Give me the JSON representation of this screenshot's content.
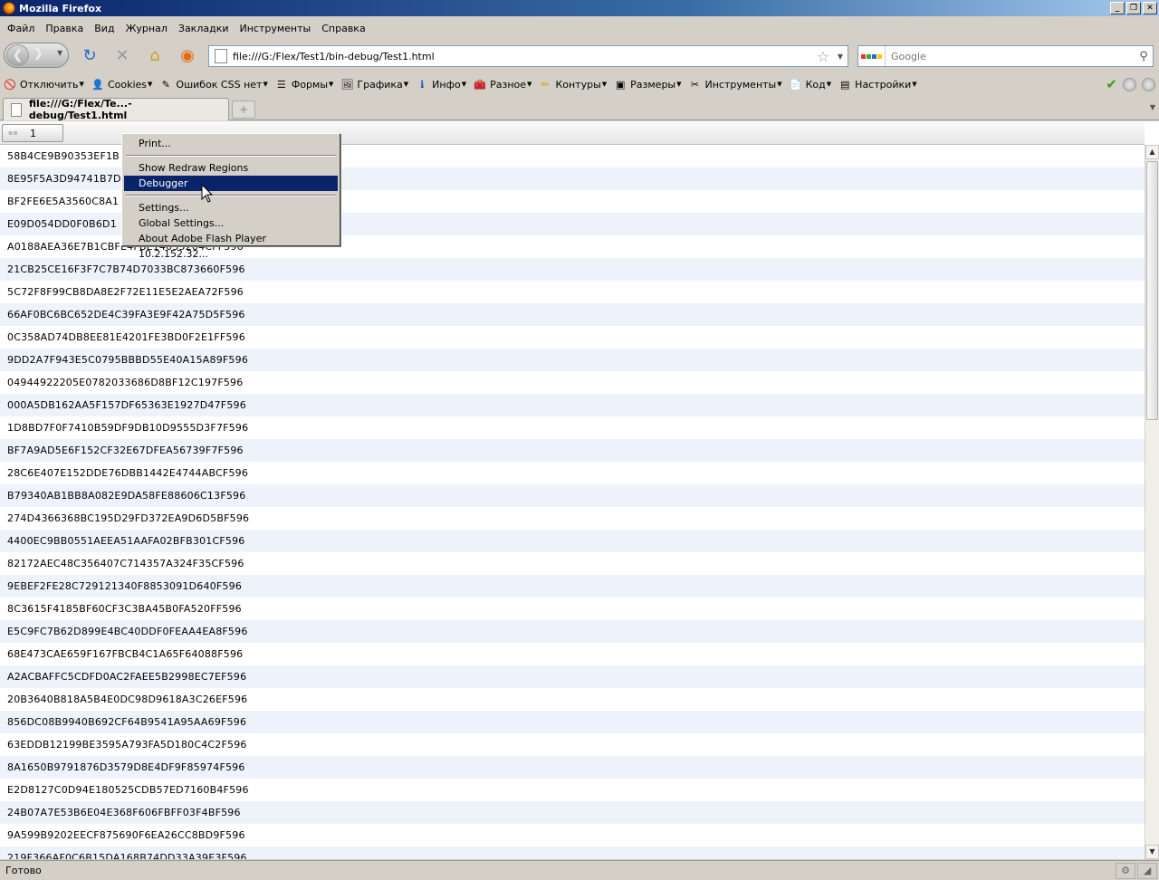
{
  "window": {
    "title": "Mozilla Firefox",
    "buttons": [
      "_",
      "❐",
      "✕"
    ]
  },
  "menu": [
    "Файл",
    "Правка",
    "Вид",
    "Журнал",
    "Закладки",
    "Инструменты",
    "Справка"
  ],
  "nav": {
    "url": "file:///G:/Flex/Test1/bin-debug/Test1.html",
    "search_placeholder": "Google"
  },
  "devbar": [
    {
      "label": "Отключить",
      "icon": "🚫"
    },
    {
      "label": "Cookies",
      "icon": "👤"
    },
    {
      "label": "Ошибок CSS нет",
      "icon": "✎"
    },
    {
      "label": "Формы",
      "icon": "☰"
    },
    {
      "label": "Графика",
      "icon": "🖼"
    },
    {
      "label": "Инфо",
      "icon": "ℹ"
    },
    {
      "label": "Разное",
      "icon": "🧰"
    },
    {
      "label": "Контуры",
      "icon": "✏"
    },
    {
      "label": "Размеры",
      "icon": "▣"
    },
    {
      "label": "Инструменты",
      "icon": "✂"
    },
    {
      "label": "Код",
      "icon": "📄"
    },
    {
      "label": "Настройки",
      "icon": "▤"
    }
  ],
  "tab": {
    "title": "file:///G:/Flex/Te...-debug/Test1.html"
  },
  "grid": {
    "header": "1",
    "rows": [
      "58B4CE9B90353EF1B",
      "8E95F5A3D94741B7D",
      "BF2FE6E5A3560C8A1",
      "E09D054DD0F0B6D1",
      "A0188AEA36E7B1CBFE4FBE14035204CFF596",
      "21CB25CE16F3F7C7B74D7033BC873660F596",
      "5C72F8F99CB8DA8E2F72E11E5E2AEA72F596",
      "66AF0BC6BC652DE4C39FA3E9F42A75D5F596",
      "0C358AD74DB8EE81E4201FE3BD0F2E1FF596",
      "9DD2A7F943E5C0795BBBD55E40A15A89F596",
      "04944922205E0782033686D8BF12C197F596",
      "000A5DB162AA5F157DF65363E1927D47F596",
      "1D8BD7F0F7410B59DF9DB10D9555D3F7F596",
      "BF7A9AD5E6F152CF32E67DFEA56739F7F596",
      "28C6E407E152DDE76DBB1442E4744ABCF596",
      "B79340AB1BB8A082E9DA58FE88606C13F596",
      "274D4366368BC195D29FD372EA9D6D5BF596",
      "4400EC9BB0551AEEA51AAFA02BFB301CF596",
      "82172AEC48C356407C714357A324F35CF596",
      "9EBEF2FE28C729121340F8853091D640F596",
      "8C3615F4185BF60CF3C3BA45B0FA520FF596",
      "E5C9FC7B62D899E4BC40DDF0FEAA4EA8F596",
      "68E473CAE659F167FBCB4C1A65F64088F596",
      "A2ACBAFFC5CDFD0AC2FAEE5B2998EC7EF596",
      "20B3640B818A5B4E0DC98D9618A3C26EF596",
      "856DC08B9940B692CF64B9541A95AA69F596",
      "63EDDB12199BE3595A793FA5D180C4C2F596",
      "8A1650B9791876D3579D8E4DF9F85974F596",
      "E2D8127C0D94E180525CDB57ED7160B4F596",
      "24B07A7E53B6E04E368F606FBFF03F4BF596",
      "9A599B9202EECF875690F6EA26CC8BD9F596",
      "219F366AF0C6B15DA168B74DD33A39E3F596"
    ]
  },
  "context_menu": {
    "items": [
      {
        "label": "Print...",
        "active": false,
        "sep_after": true
      },
      {
        "label": "Show Redraw Regions",
        "active": false,
        "sep_after": false
      },
      {
        "label": "Debugger",
        "active": true,
        "sep_after": true
      },
      {
        "label": "Settings...",
        "active": false,
        "sep_after": false
      },
      {
        "label": "Global Settings...",
        "active": false,
        "sep_after": false
      },
      {
        "label": "About Adobe Flash Player 10.2.152.32...",
        "active": false,
        "sep_after": false
      }
    ]
  },
  "status": {
    "text": "Готово"
  },
  "colors": {
    "selection": "#0a246a",
    "row_alt": "#eef3fb"
  }
}
